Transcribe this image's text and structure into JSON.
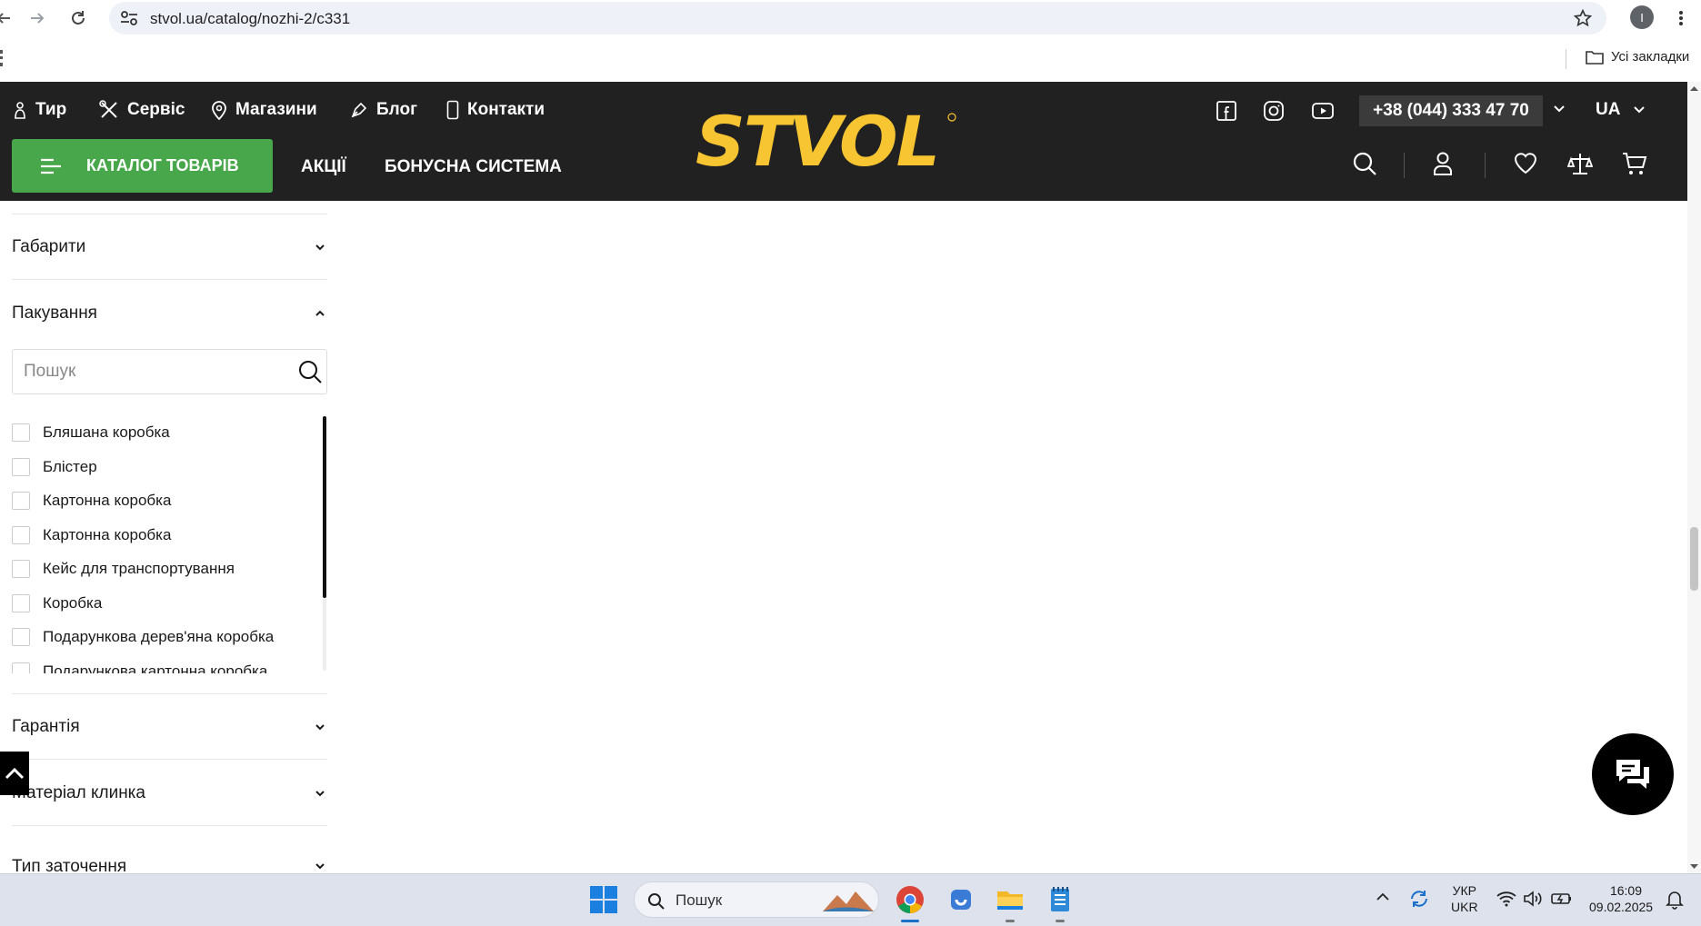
{
  "browser": {
    "url": "stvol.ua/catalog/nozhi-2/c331",
    "profile_initial": "I",
    "bookmarks_label": "Усі закладки"
  },
  "header": {
    "top_nav": [
      {
        "label": "Тир",
        "icon": "target-figure-icon"
      },
      {
        "label": "Сервіс",
        "icon": "tools-icon"
      },
      {
        "label": "Магазини",
        "icon": "location-pin-icon"
      },
      {
        "label": "Блог",
        "icon": "pen-icon"
      },
      {
        "label": "Контакти",
        "icon": "phone-icon"
      }
    ],
    "socials": [
      "facebook-icon",
      "instagram-icon",
      "youtube-icon"
    ],
    "phone": "+38 (044) 333 47 70",
    "language": "UA",
    "catalog_button": "КАТАЛОГ ТОВАРІВ",
    "menu": [
      "АКЦІЇ",
      "БОНУСНА СИСТЕМА"
    ],
    "logo": "STVOL",
    "brand_color": "#f7c531",
    "accent_green": "#47a74a"
  },
  "sidebar": {
    "sections_top": [
      {
        "label": "Габарити",
        "expanded": false
      },
      {
        "label": "Пакування",
        "expanded": true
      }
    ],
    "search_placeholder": "Пошук",
    "packaging_options": [
      "Бляшана коробка",
      "Блістер",
      "Картонна коробка",
      "Картонна коробка",
      "Кейс для транспортування",
      "Коробка",
      "Подарункова дерев'яна коробка",
      "Подарункова картонна коробка"
    ],
    "sections_bottom": [
      {
        "label": "Гарантія",
        "expanded": false
      },
      {
        "label": "Матеріал клинка",
        "expanded": false
      },
      {
        "label": "Тип заточення",
        "expanded": false
      }
    ]
  },
  "taskbar": {
    "search_label": "Пошук",
    "lang_top": "УКР",
    "lang_bottom": "UKR",
    "time": "16:09",
    "date": "09.02.2025"
  }
}
